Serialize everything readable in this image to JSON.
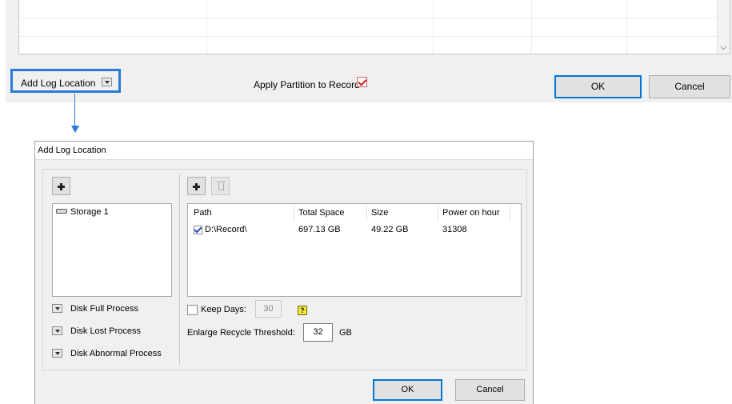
{
  "main_window": {
    "add_log_location_label": "Add Log Location",
    "apply_partition_label": "Apply Partition to Record",
    "apply_partition_checked": true,
    "ok_label": "OK",
    "cancel_label": "Cancel"
  },
  "dialog": {
    "title": "Add Log Location",
    "storage_list": [
      {
        "label": "Storage 1",
        "icon": "hard-drive-icon"
      }
    ],
    "processes": [
      {
        "label": "Disk Full Process"
      },
      {
        "label": "Disk Lost Process"
      },
      {
        "label": "Disk Abnormal Process"
      }
    ],
    "table": {
      "columns": [
        "Path",
        "Total Space",
        "Size",
        "Power on hour"
      ],
      "rows": [
        {
          "checked": true,
          "path": "D:\\Record\\",
          "total_space": "697.13 GB",
          "size": "49.22 GB",
          "power_on_hour": "31308"
        }
      ]
    },
    "keep_days": {
      "label": "Keep Days:",
      "checked": false,
      "value": "30"
    },
    "help_icon_text": "?",
    "enlarge_recycle": {
      "label": "Enlarge Recycle Threshold:",
      "value": "32",
      "unit": "GB"
    },
    "ok_label": "OK",
    "cancel_label": "Cancel"
  },
  "colors": {
    "highlight": "#2a7bd8",
    "default_button_border": "#0078d7",
    "help_icon": "#f6e83a"
  }
}
